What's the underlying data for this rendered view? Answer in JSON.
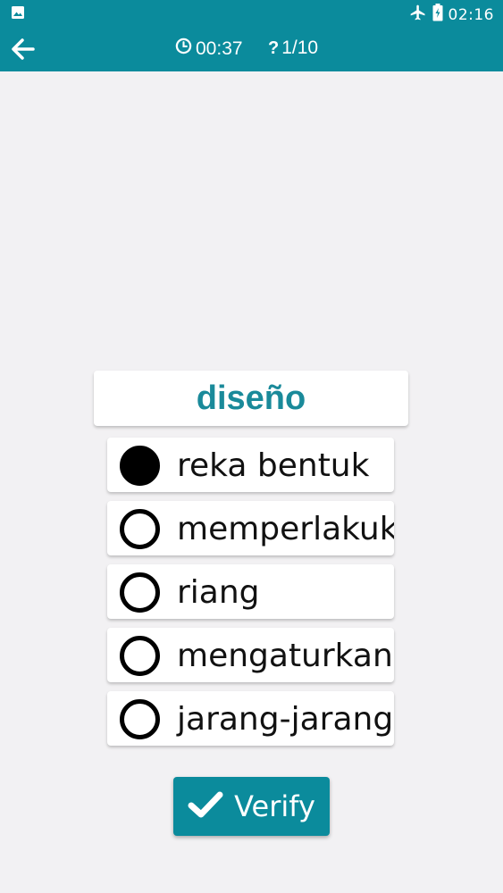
{
  "status_bar": {
    "time": "02:16",
    "left_icon": "image-notification-icon",
    "icons": [
      "airplane-mode-icon",
      "battery-charging-icon"
    ]
  },
  "app_bar": {
    "back_icon": "back-arrow-icon",
    "timer": "00:37",
    "progress": "1/10"
  },
  "question": {
    "word": "diseño"
  },
  "options": [
    {
      "label": "reka bentuk",
      "selected": true
    },
    {
      "label": "memperlakukan",
      "selected": false
    },
    {
      "label": "riang",
      "selected": false
    },
    {
      "label": "mengaturkan",
      "selected": false
    },
    {
      "label": "jarang-jarang",
      "selected": false
    }
  ],
  "verify_button": {
    "label": "Verify",
    "icon": "check-icon"
  },
  "colors": {
    "primary": "#0b8b9c",
    "word": "#1a8a9a",
    "background": "#f2f1f3"
  }
}
